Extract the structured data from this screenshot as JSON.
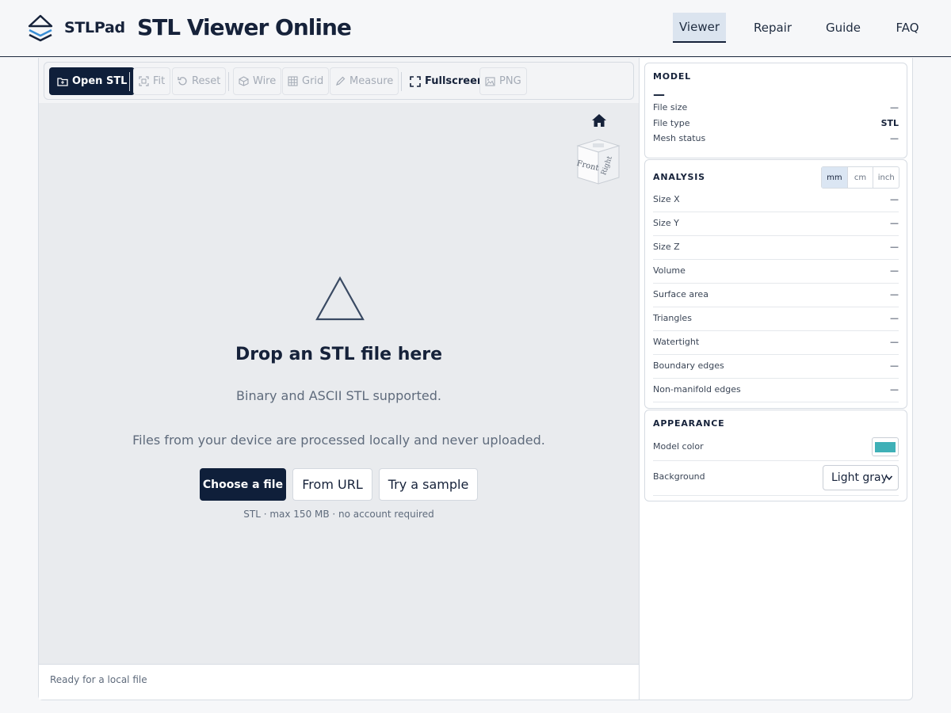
{
  "header": {
    "brand": "STLPad",
    "title": "STL Viewer Online",
    "nav": [
      {
        "label": "Viewer",
        "active": true
      },
      {
        "label": "Repair",
        "active": false
      },
      {
        "label": "Guide",
        "active": false
      },
      {
        "label": "FAQ",
        "active": false
      }
    ]
  },
  "toolbar": {
    "open": {
      "label": "Open STL",
      "icon": "folder-icon"
    },
    "fit": {
      "label": "Fit",
      "icon": "fit-icon",
      "disabled": true
    },
    "reset": {
      "label": "Reset",
      "icon": "reset-icon",
      "disabled": true
    },
    "wire": {
      "label": "Wire",
      "icon": "cube-wire-icon",
      "disabled": true
    },
    "grid": {
      "label": "Grid",
      "icon": "grid-icon",
      "disabled": true
    },
    "measure": {
      "label": "Measure",
      "icon": "pencil-icon",
      "disabled": true
    },
    "fullscreen": {
      "label": "Fullscreen",
      "icon": "fullscreen-icon"
    },
    "png": {
      "label": "PNG",
      "icon": "image-icon",
      "disabled": true
    }
  },
  "viewer": {
    "view_cube_faces": {
      "front": "Front",
      "right": "Right"
    },
    "drop_title": "Drop an STL file here",
    "drop_sub1": "Binary and ASCII STL supported.",
    "drop_sub2": "Files from your device are processed locally and never uploaded.",
    "choose_file": "Choose a file",
    "from_url": "From URL",
    "try_sample": "Try a sample",
    "note": "STL · max 150 MB · no account required",
    "status": "Ready for a local file"
  },
  "model": {
    "title": "MODEL",
    "name": "—",
    "rows": [
      {
        "label": "File size",
        "value": "—"
      },
      {
        "label": "File type",
        "value": "STL"
      },
      {
        "label": "Mesh status",
        "value": "—"
      }
    ]
  },
  "analysis": {
    "title": "ANALYSIS",
    "units": [
      {
        "label": "mm",
        "active": true
      },
      {
        "label": "cm",
        "active": false
      },
      {
        "label": "inch",
        "active": false
      }
    ],
    "rows": [
      {
        "label": "Size X",
        "value": "—"
      },
      {
        "label": "Size Y",
        "value": "—"
      },
      {
        "label": "Size Z",
        "value": "—"
      },
      {
        "label": "Volume",
        "value": "—"
      },
      {
        "label": "Surface area",
        "value": "—"
      },
      {
        "label": "Triangles",
        "value": "—"
      },
      {
        "label": "Watertight",
        "value": "—"
      },
      {
        "label": "Boundary edges",
        "value": "—"
      },
      {
        "label": "Non-manifold edges",
        "value": "—"
      }
    ]
  },
  "appearance": {
    "title": "APPEARANCE",
    "model_color_label": "Model color",
    "model_color": "#3fb0b7",
    "background_label": "Background",
    "background_value": "Light gray"
  }
}
